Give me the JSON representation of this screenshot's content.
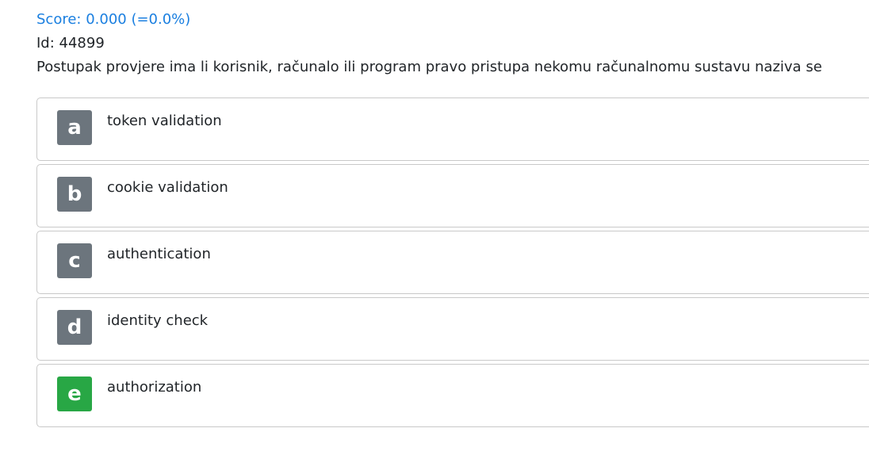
{
  "header": {
    "score": "Score: 0.000 (=0.0%)",
    "id": "Id: 44899",
    "question": "Postupak provjere ima li korisnik, računalo ili program pravo pristupa nekomu računalnomu sustavu naziva se"
  },
  "answers": [
    {
      "letter": "a",
      "text": "token validation",
      "correct": false
    },
    {
      "letter": "b",
      "text": "cookie validation",
      "correct": false
    },
    {
      "letter": "c",
      "text": "authentication",
      "correct": false
    },
    {
      "letter": "d",
      "text": "identity check",
      "correct": false
    },
    {
      "letter": "e",
      "text": "authorization",
      "correct": true
    }
  ],
  "colors": {
    "score": "#1a7fe0",
    "badge_default": "#6c757d",
    "badge_correct": "#28a745"
  }
}
